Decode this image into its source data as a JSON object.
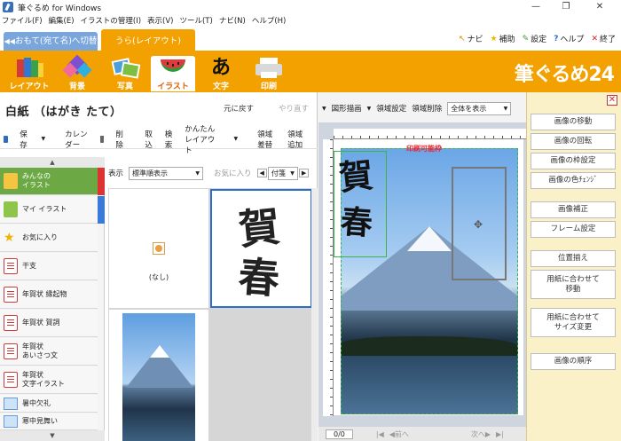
{
  "window": {
    "title": "筆ぐるめ for Windows",
    "minimize": "—",
    "restore": "❐",
    "close": "✕"
  },
  "menu": [
    "ファイル(F)",
    "編集(E)",
    "イラストの管理(I)",
    "表示(V)",
    "ツール(T)",
    "ナビ(N)",
    "ヘルプ(H)"
  ],
  "mode_tabs": {
    "front": "おもて(宛て名)へ切替",
    "back": "うら(レイアウト)"
  },
  "top_links": [
    "ナビ",
    "補助",
    "設定",
    "ヘルプ",
    "終了"
  ],
  "tools": [
    "レイアウト",
    "背景",
    "写真",
    "イラスト",
    "文字",
    "印刷"
  ],
  "brand": "筆ぐるめ24",
  "left": {
    "title": "白紙 （はがき たて）",
    "undo": "元に戻す",
    "redo": "やり直す",
    "toolbar": [
      "保存",
      "カレンダー",
      "削除",
      "取込",
      "検索",
      "かんたんレイアウト",
      "領域差替",
      "領域追加"
    ],
    "categories": [
      "みんなの\nイラスト",
      "マイ イラスト",
      "お気に入り",
      "干支",
      "年賀状 縁起物",
      "年賀状 賀詞",
      "年賀状\nあいさつ文",
      "年賀状\n文字イラスト",
      "暑中欠礼",
      "寒中見舞い"
    ],
    "filter": {
      "label": "表示",
      "value": "標準順表示",
      "fav": "お気に入り",
      "sort": "付箋"
    },
    "none_label": "(なし)"
  },
  "right": {
    "toolbar": [
      "図形描画",
      "領域設定",
      "領域削除"
    ],
    "view": "全体を表示",
    "print_range": "印刷可能枠",
    "page": "0/0",
    "prev": "前へ",
    "next": "次へ",
    "side_buttons": [
      "画像の移動",
      "画像の回転",
      "画像の枠設定",
      "画像の色ﾁｪﾝｼﾞ",
      "画像補正",
      "フレーム設定",
      "位置揃え",
      "用紙に合わせて\n移動",
      "用紙に合わせて\nサイズ変更",
      "画像の順序"
    ]
  },
  "greeting": [
    "賀",
    "春"
  ],
  "colors": {
    "orange": "#f2a100",
    "green": "#6ca944",
    "blue": "#2e6cc9",
    "panel": "#fbf1c9"
  }
}
